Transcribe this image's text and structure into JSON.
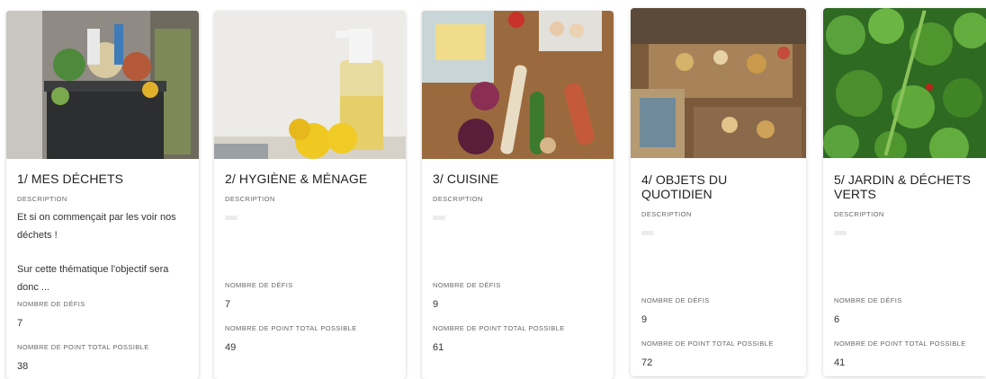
{
  "labels": {
    "description": "DESCRIPTION",
    "challenges": "NOMBRE DE DÉFIS",
    "points": "NOMBRE DE POINT TOTAL POSSIBLE"
  },
  "cards": [
    {
      "title": "1/ MES DÉCHETS",
      "description_line1": "Et si on commençait par les voir nos",
      "description_line2": "déchets !",
      "description_line3": "Sur cette thématique l'objectif sera donc ...",
      "challenges": "7",
      "points": "38"
    },
    {
      "title": "2/ HYGIÈNE & MÉNAGE",
      "challenges": "7",
      "points": "49"
    },
    {
      "title": "3/ CUISINE",
      "challenges": "9",
      "points": "61"
    },
    {
      "title": "4/ OBJETS DU QUOTIDIEN",
      "challenges": "9",
      "points": "72"
    },
    {
      "title": "5/ JARDIN & DÉCHETS VERTS",
      "challenges": "6",
      "points": "41"
    }
  ]
}
